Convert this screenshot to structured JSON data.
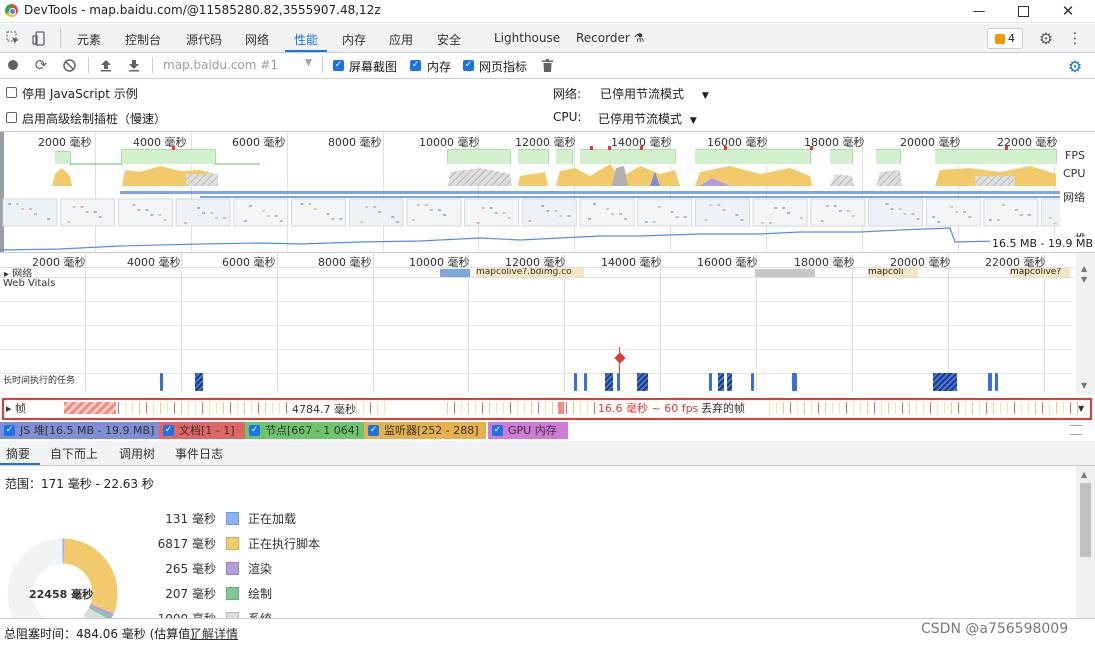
{
  "window": {
    "title": "DevTools - map.baidu.com/@11585280.82,3555907.48,12z"
  },
  "tabs": {
    "items": [
      "元素",
      "控制台",
      "源代码",
      "网络",
      "性能",
      "内存",
      "应用",
      "安全",
      "Lighthouse",
      "Recorder ⚗"
    ],
    "active": "性能",
    "issues_count": "4"
  },
  "toolbar": {
    "recording_select": "map.baidu.com #1",
    "screenshots_label": "屏幕截图",
    "memory_label": "内存",
    "webvitals_label": "网页指标"
  },
  "settings": {
    "disable_js_samples": "停用 JavaScript 示例",
    "enable_paint_instrumentation": "启用高级绘制插桩（慢速）",
    "network_label": "网络:",
    "network_value": "已停用节流模式",
    "cpu_label": "CPU:",
    "cpu_value": "已停用节流模式"
  },
  "overview": {
    "ticks": [
      "2000 毫秒",
      "4000 毫秒",
      "6000 毫秒",
      "8000 毫秒",
      "10000 毫秒",
      "12000 毫秒",
      "14000 毫秒",
      "16000 毫秒",
      "18000 毫秒",
      "20000 毫秒",
      "22000 毫秒"
    ],
    "lane_fps": "FPS",
    "lane_cpu": "CPU",
    "lane_net": "网络",
    "lane_heap": "堆",
    "heap_range": "16.5 MB - 19.9 MB"
  },
  "flame": {
    "ticks": [
      "2000 毫秒",
      "4000 毫秒",
      "6000 毫秒",
      "8000 毫秒",
      "10000 毫秒",
      "12000 毫秒",
      "14000 毫秒",
      "16000 毫秒",
      "18000 毫秒",
      "20000 毫秒",
      "22000 毫秒"
    ],
    "network_track": "网络",
    "web_vitals": "Web Vitals",
    "long_tasks": "长时间执行的任务",
    "network_item_1": "mapcolive?.bdimg.co",
    "network_item_2": "mapcoli",
    "network_item_3": "mapcolive?"
  },
  "frames": {
    "label": "帧",
    "duration": "4784.7 毫秒",
    "fps_text": "16.6 毫秒 ~ 60 fps",
    "dropped_text": "丢弃的帧"
  },
  "counters": [
    {
      "label": "JS 堆[16.5 MB - 19.9 MB]",
      "color": "#7e8fd6"
    },
    {
      "label": "文档[1 - 1]",
      "color": "#e06666"
    },
    {
      "label": "节点[667 - 1 064]",
      "color": "#6cc46c"
    },
    {
      "label": "监听器[252 - 288]",
      "color": "#e8b04a"
    },
    {
      "label": "GPU 内存",
      "color": "#d07cd6"
    }
  ],
  "bottom_tabs": {
    "items": [
      "摘要",
      "自下而上",
      "调用树",
      "事件日志"
    ],
    "active": "摘要"
  },
  "summary": {
    "range": "范围：171 毫秒 - 22.63 秒",
    "total": "22458 毫秒",
    "rows": [
      {
        "value": "131 毫秒",
        "label": "正在加载",
        "color": "#8ab4f8"
      },
      {
        "value": "6817 毫秒",
        "label": "正在执行脚本",
        "color": "#f2ca6b"
      },
      {
        "value": "265 毫秒",
        "label": "渲染",
        "color": "#b39ddb"
      },
      {
        "value": "207 毫秒",
        "label": "绘制",
        "color": "#81c995"
      },
      {
        "value": "1000 毫秒",
        "label": "系统",
        "color": "#dadce0"
      }
    ]
  },
  "status": {
    "blocking_time": "总阻塞时间：484.06 毫秒 (估算值)",
    "learn_more": "了解详情",
    "watermark": "CSDN @a756598009"
  }
}
